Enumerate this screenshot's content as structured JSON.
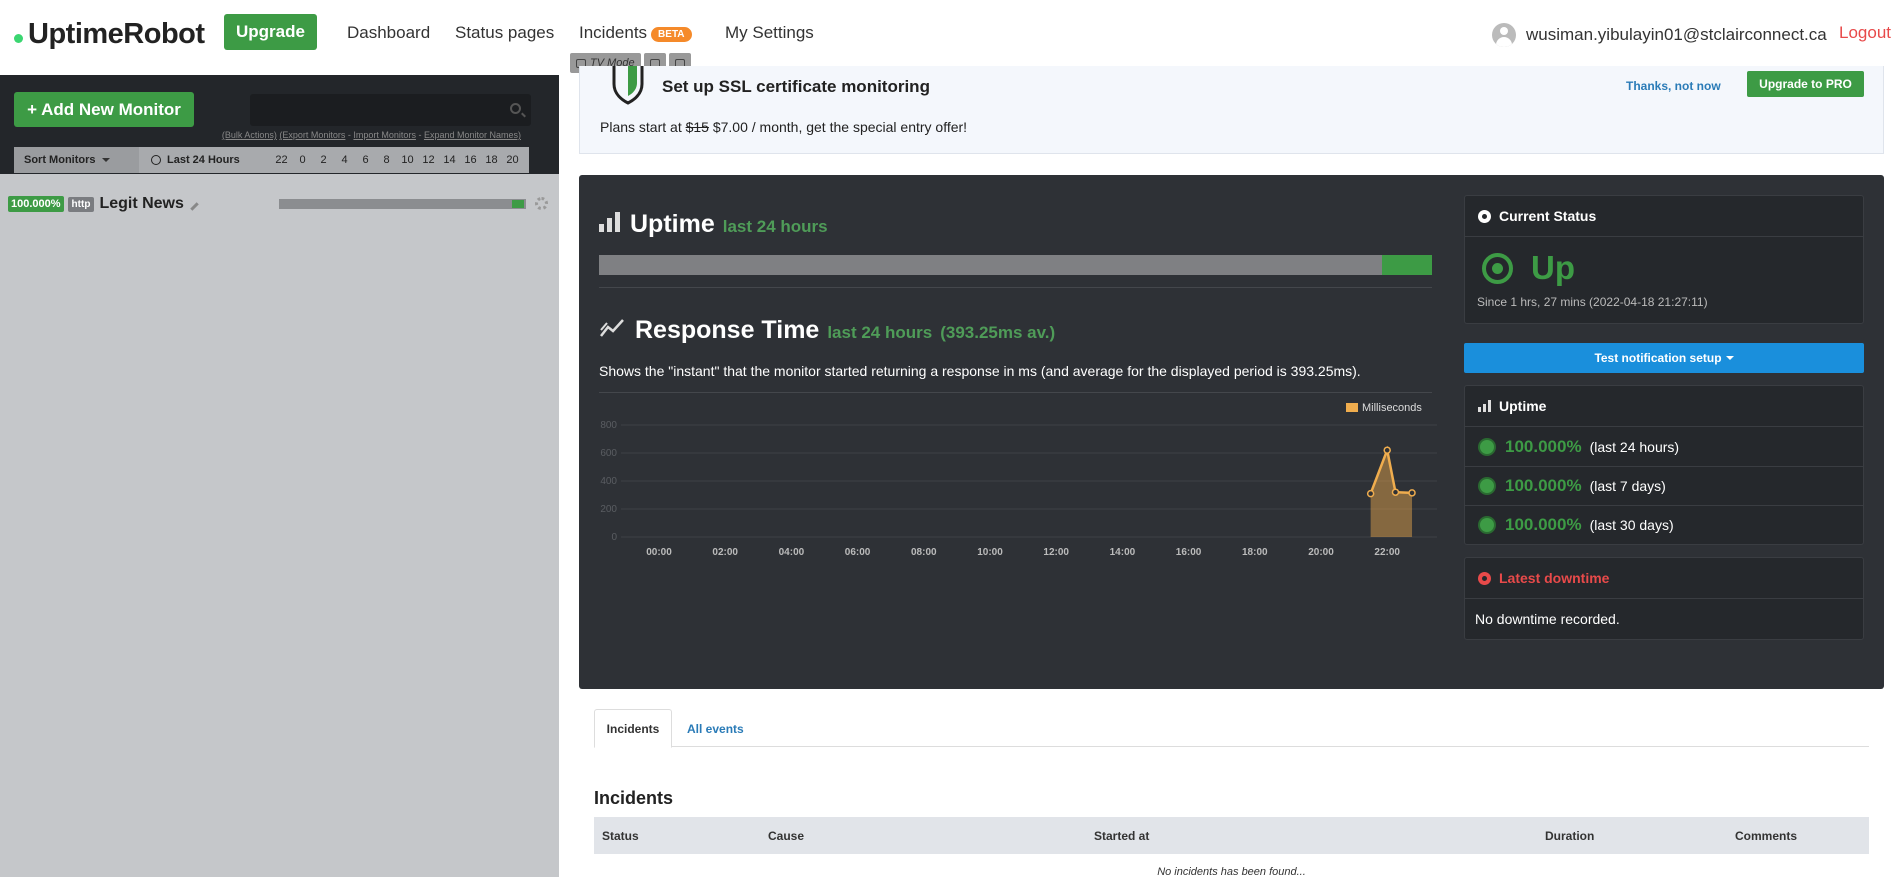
{
  "nav": {
    "logo": "UptimeRobot",
    "upgrade": "Upgrade",
    "dashboard": "Dashboard",
    "status_pages": "Status pages",
    "incidents": "Incidents",
    "beta": "BETA",
    "my_settings": "My Settings",
    "user_email": "wusiman.yibulayin01@stclairconnect.ca",
    "logout": "Logout"
  },
  "tv_mode": "TV Mode",
  "sidebar": {
    "add_monitor": "+ Add New Monitor",
    "search_placeholder": "",
    "bulk_actions": "(Bulk Actions)",
    "export_monitors": "(Export Monitors",
    "import_monitors": "Import Monitors",
    "expand_names": "Expand Monitor Names)",
    "sort_label": "Sort Monitors",
    "range_label": "Last 24 Hours",
    "hours": [
      "22",
      "0",
      "2",
      "4",
      "6",
      "8",
      "10",
      "12",
      "14",
      "16",
      "18",
      "20"
    ],
    "monitor": {
      "uptime": "100.000%",
      "type": "http",
      "name": "Legit News"
    }
  },
  "ssl": {
    "title": "Set up SSL certificate monitoring",
    "plans_prefix": "Plans start at",
    "old_price": "$15",
    "offer": "$7.00 / month, get the special entry offer!",
    "dismiss": "Thanks, not now",
    "upgrade": "Upgrade to PRO"
  },
  "uptime_section": {
    "title": "Uptime",
    "period": "last 24 hours",
    "fraction_up": 0.06
  },
  "response_section": {
    "title": "Response Time",
    "period": "last 24 hours",
    "avg": "(393.25ms av.)",
    "description": "Shows the \"instant\" that the monitor started returning a response in ms (and average for the displayed period is 393.25ms)."
  },
  "chart_data": {
    "type": "area",
    "series": [
      {
        "name": "Milliseconds",
        "x": [
          "21:30",
          "22:00",
          "22:15",
          "22:45"
        ],
        "values": [
          310,
          620,
          320,
          315
        ]
      }
    ],
    "x_ticks": [
      "00:00",
      "02:00",
      "04:00",
      "06:00",
      "08:00",
      "10:00",
      "12:00",
      "14:00",
      "16:00",
      "18:00",
      "20:00",
      "22:00"
    ],
    "y_ticks": [
      0,
      200,
      400,
      600,
      800
    ],
    "ylim": [
      0,
      800
    ],
    "xlim": [
      "22:00 (prev)",
      "23:00"
    ],
    "legend_position": "top-right",
    "grid": true,
    "color": "#f0ad4e"
  },
  "current_status": {
    "title": "Current Status",
    "status": "Up",
    "since": "Since 1 hrs, 27 mins (2022-04-18 21:27:11)"
  },
  "test_notification": "Test notification setup",
  "uptime_card": {
    "title": "Uptime",
    "rows": [
      {
        "pct": "100.000%",
        "period": "(last 24 hours)"
      },
      {
        "pct": "100.000%",
        "period": "(last 7 days)"
      },
      {
        "pct": "100.000%",
        "period": "(last 30 days)"
      }
    ]
  },
  "latest_downtime": {
    "title": "Latest downtime",
    "text": "No downtime recorded."
  },
  "tabs": {
    "incidents": "Incidents",
    "all_events": "All events"
  },
  "incidents": {
    "title": "Incidents",
    "columns": [
      "Status",
      "Cause",
      "Started at",
      "Duration",
      "Comments"
    ],
    "empty": "No incidents has been found..."
  },
  "colors": {
    "brand_green": "#3d9b45",
    "panel_dark": "#2e3136",
    "accent_blue": "#1a8fdc",
    "danger_red": "#e84a4a"
  }
}
